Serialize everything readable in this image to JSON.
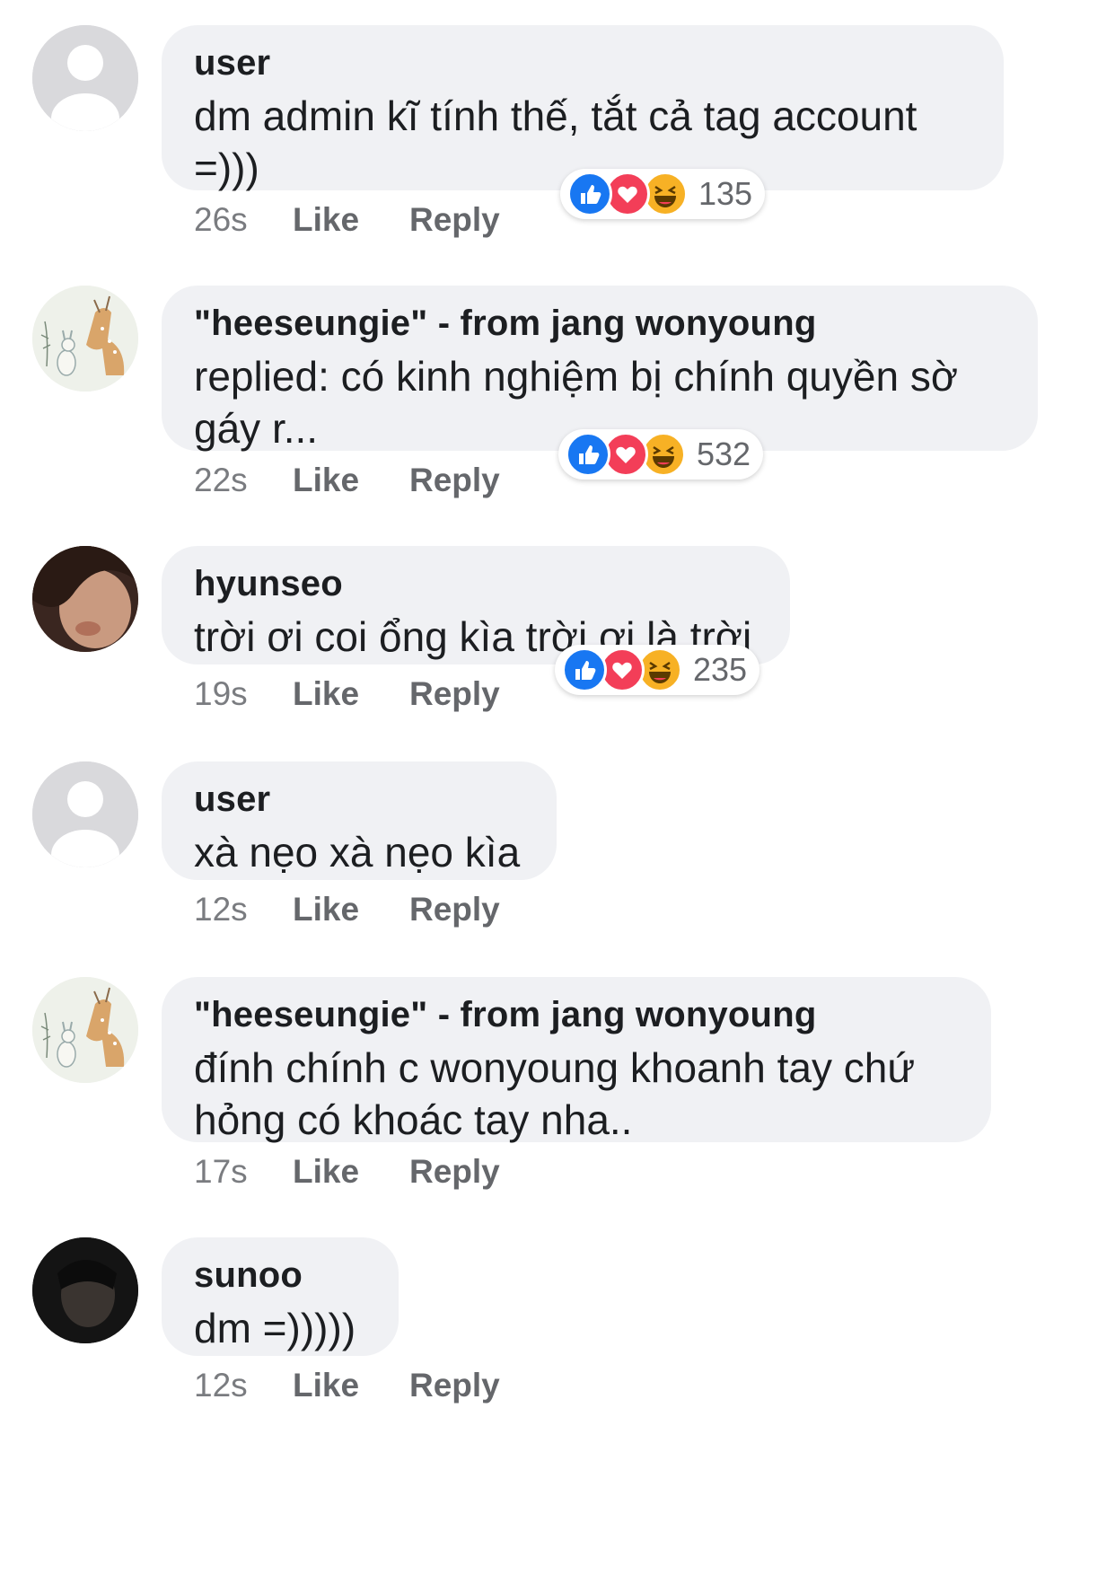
{
  "comments": [
    {
      "author": "user",
      "text": "dm admin kĩ tính thế, tắt cả tag account =)))",
      "time": "26s",
      "like_label": "Like",
      "reply_label": "Reply",
      "reactions": {
        "icons": [
          "like-icon",
          "love-icon",
          "haha-icon"
        ],
        "count": "135"
      }
    },
    {
      "author": "\"heeseungie\" - from jang wonyoung",
      "text": "replied: có kinh nghiệm bị chính quyền sờ gáy r...",
      "time": "22s",
      "like_label": "Like",
      "reply_label": "Reply",
      "reactions": {
        "icons": [
          "like-icon",
          "love-icon",
          "haha-icon"
        ],
        "count": "532"
      }
    },
    {
      "author": "hyunseo",
      "text": "trời ơi coi ổng kìa trời ơi là trời",
      "time": "19s",
      "like_label": "Like",
      "reply_label": "Reply",
      "reactions": {
        "icons": [
          "like-icon",
          "love-icon",
          "haha-icon"
        ],
        "count": "235"
      }
    },
    {
      "author": "user",
      "text": "xà nẹo xà nẹo kìa",
      "time": "12s",
      "like_label": "Like",
      "reply_label": "Reply"
    },
    {
      "author": "\"heeseungie\" - from jang wonyoung",
      "text": "đính chính c wonyoung khoanh tay chứ hỏng có khoác tay nha..",
      "time": "17s",
      "like_label": "Like",
      "reply_label": "Reply"
    },
    {
      "author": "sunoo",
      "text": "dm =)))))",
      "time": "12s",
      "like_label": "Like",
      "reply_label": "Reply"
    }
  ],
  "colors": {
    "bubble": "#f0f1f4",
    "like": "#1877f2",
    "love": "#f33e58",
    "haha": "#f7b125",
    "meta_text": "#65676b"
  }
}
